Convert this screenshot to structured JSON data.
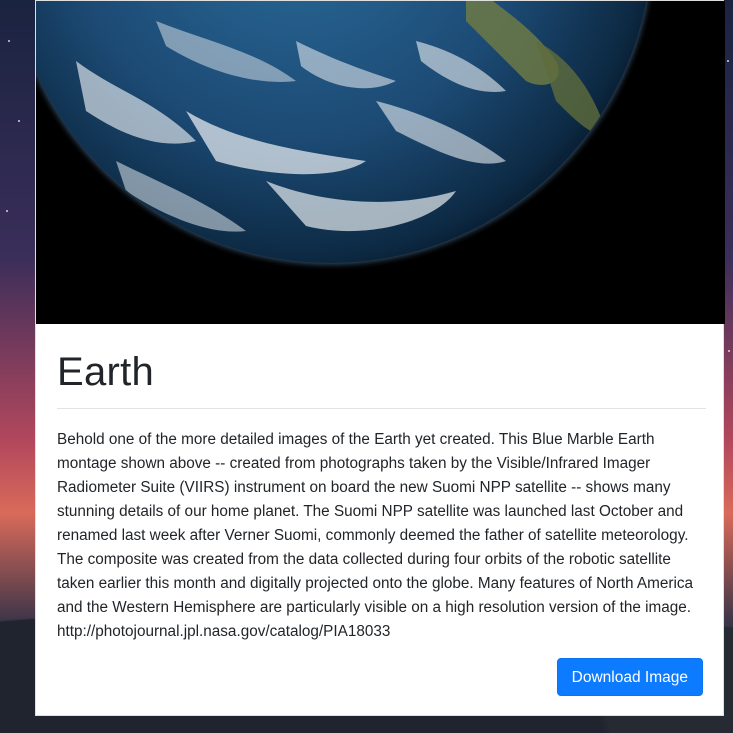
{
  "card": {
    "title": "Earth",
    "description": "Behold one of the more detailed images of the Earth yet created. This Blue Marble Earth montage shown above -- created from photographs taken by the Visible/Infrared Imager Radiometer Suite (VIIRS) instrument on board the new Suomi NPP satellite -- shows many stunning details of our home planet. The Suomi NPP satellite was launched last October and renamed last week after Verner Suomi, commonly deemed the father of satellite meteorology. The composite was created from the data collected during four orbits of the robotic satellite taken earlier this month and digitally projected onto the globe. Many features of North America and the Western Hemisphere are particularly visible on a high resolution version of the image. http://photojournal.jpl.nasa.gov/catalog/PIA18033",
    "download_label": "Download Image"
  },
  "colors": {
    "button_bg": "#0d7bff",
    "card_bg": "#ffffff",
    "image_bg": "#000000"
  }
}
